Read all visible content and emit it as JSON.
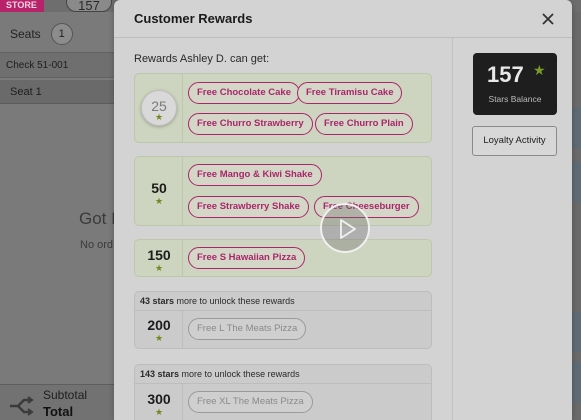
{
  "background": {
    "store_label": "STORE",
    "order_count": "157",
    "seats_label": "Seats",
    "seats_count": "1",
    "check_label": "Check  51-001",
    "seat_label": "Seat 1",
    "empty_title": "Got I",
    "empty_subtitle": "No ord",
    "subtotal_label": "Subtotal",
    "total_label": "Total"
  },
  "modal": {
    "title": "Customer Rewards",
    "intro": "Rewards Ashley D. can get:",
    "tiers": [
      {
        "stars": "25",
        "star_glyph": "★",
        "rewards": [
          "Free Chocolate Cake",
          "Free Tiramisu Cake",
          "Free Churro Strawberry",
          "Free Churro Plain"
        ]
      },
      {
        "stars": "50",
        "star_glyph": "★",
        "rewards": [
          "Free Mango & Kiwi Shake",
          "Free Strawberry Shake",
          "Free Cheeseburger"
        ]
      },
      {
        "stars": "150",
        "star_glyph": "★",
        "rewards": [
          "Free S Hawaiian Pizza"
        ]
      }
    ],
    "locked_tiers": [
      {
        "needed": "43 stars",
        "suffix": " more to unlock these rewards",
        "stars": "200",
        "star_glyph": "★",
        "rewards": [
          "Free L The Meats Pizza"
        ]
      },
      {
        "needed": "143 stars",
        "suffix": " more to unlock these rewards",
        "stars": "300",
        "star_glyph": "★",
        "rewards": [
          "Free XL The Meats Pizza"
        ]
      }
    ],
    "balance": {
      "value": "157",
      "star_glyph": "★",
      "label": "Stars Balance"
    },
    "loyalty_button": "Loyalty Activity"
  },
  "colors": {
    "accent": "#a8276a",
    "star": "#7a9a26",
    "tier_bg": "#cdd4bf",
    "balance_bg": "#1e1e1e"
  },
  "icons": {
    "close": "close-icon",
    "play": "play-icon",
    "star": "star-icon",
    "split": "split-check-icon"
  }
}
